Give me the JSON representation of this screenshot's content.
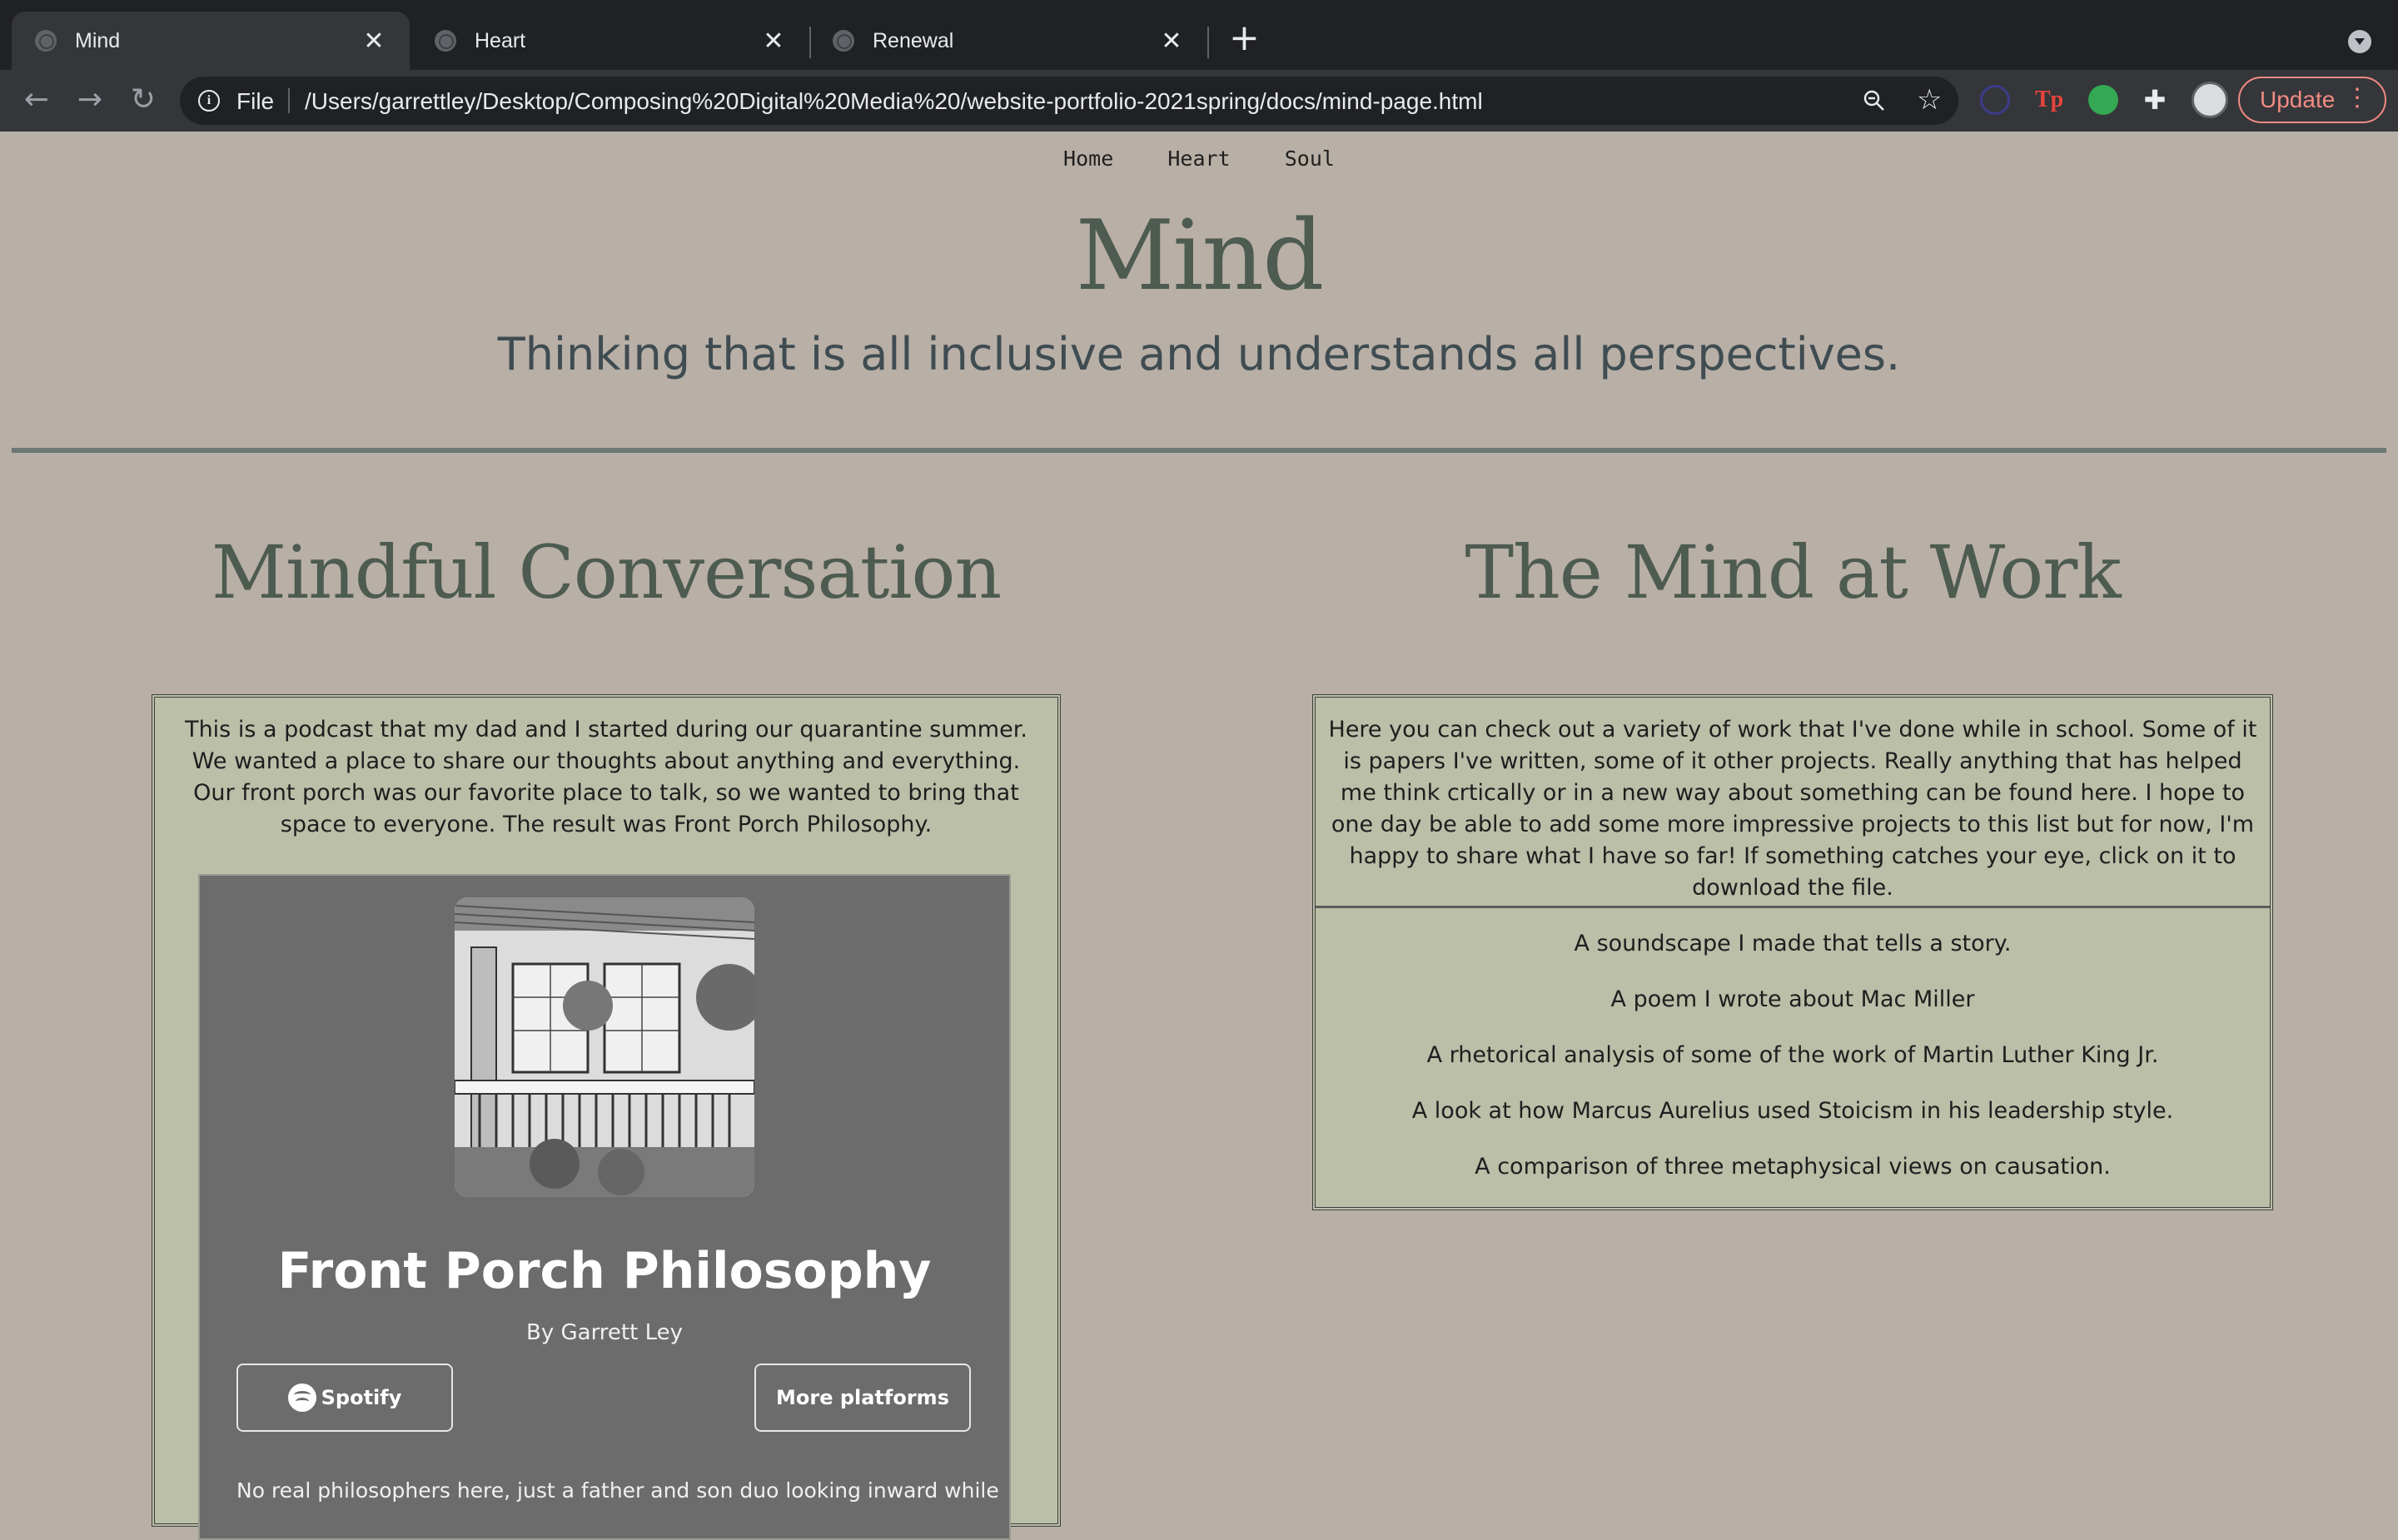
{
  "browser": {
    "tabs": [
      {
        "title": "Mind",
        "active": true
      },
      {
        "title": "Heart",
        "active": false
      },
      {
        "title": "Renewal",
        "active": false
      }
    ],
    "scheme_label": "File",
    "url": "/Users/garrettley/Desktop/Composing%20Digital%20Media%20/website-portfolio-2021spring/docs/mind-page.html",
    "update_label": "Update"
  },
  "nav": {
    "items": [
      "Home",
      "Heart",
      "Soul"
    ]
  },
  "header": {
    "title": "Mind",
    "subtitle": "Thinking that is all inclusive and understands all perspectives."
  },
  "left": {
    "heading": "Mindful Conversation",
    "description": "This is a podcast that my dad and I started during our quarantine summer. We wanted a place to share our thoughts about anything and everything. Our front porch was our favorite place to talk, so we wanted to bring that space to everyone. The result was Front Porch Philosophy.",
    "embed": {
      "show_title": "Front Porch Philosophy",
      "author": "By Garrett Ley",
      "spotify_label": "Spotify",
      "more_label": "More platforms",
      "blurb": "No real philosophers here, just a father and son duo looking inward while"
    }
  },
  "right": {
    "heading": "The Mind at Work",
    "description": "Here you can check out a variety of work that I've done while in school. Some of it is papers I've written, some of it other projects. Really anything that has helped me think crtically or in a new way about something can be found here. I hope to one day be able to add some more impressive projects to this list but for now, I'm happy to share what I have so far! If something catches your eye, click on it to download the file.",
    "items": [
      "A soundscape I made that tells a story.",
      "A poem I wrote about Mac Miller",
      "A rhetorical analysis of some of the work of Martin Luther King Jr.",
      "A look at how Marcus Aurelius used Stoicism in his leadership style.",
      "A comparison of three metaphysical views on causation."
    ]
  },
  "colors": {
    "page_bg": "#b8afa6",
    "heading": "#4d5b50",
    "card_bg": "#bbbfa8",
    "embed_bg": "#6c6c6c",
    "update_accent": "#f28b82"
  }
}
